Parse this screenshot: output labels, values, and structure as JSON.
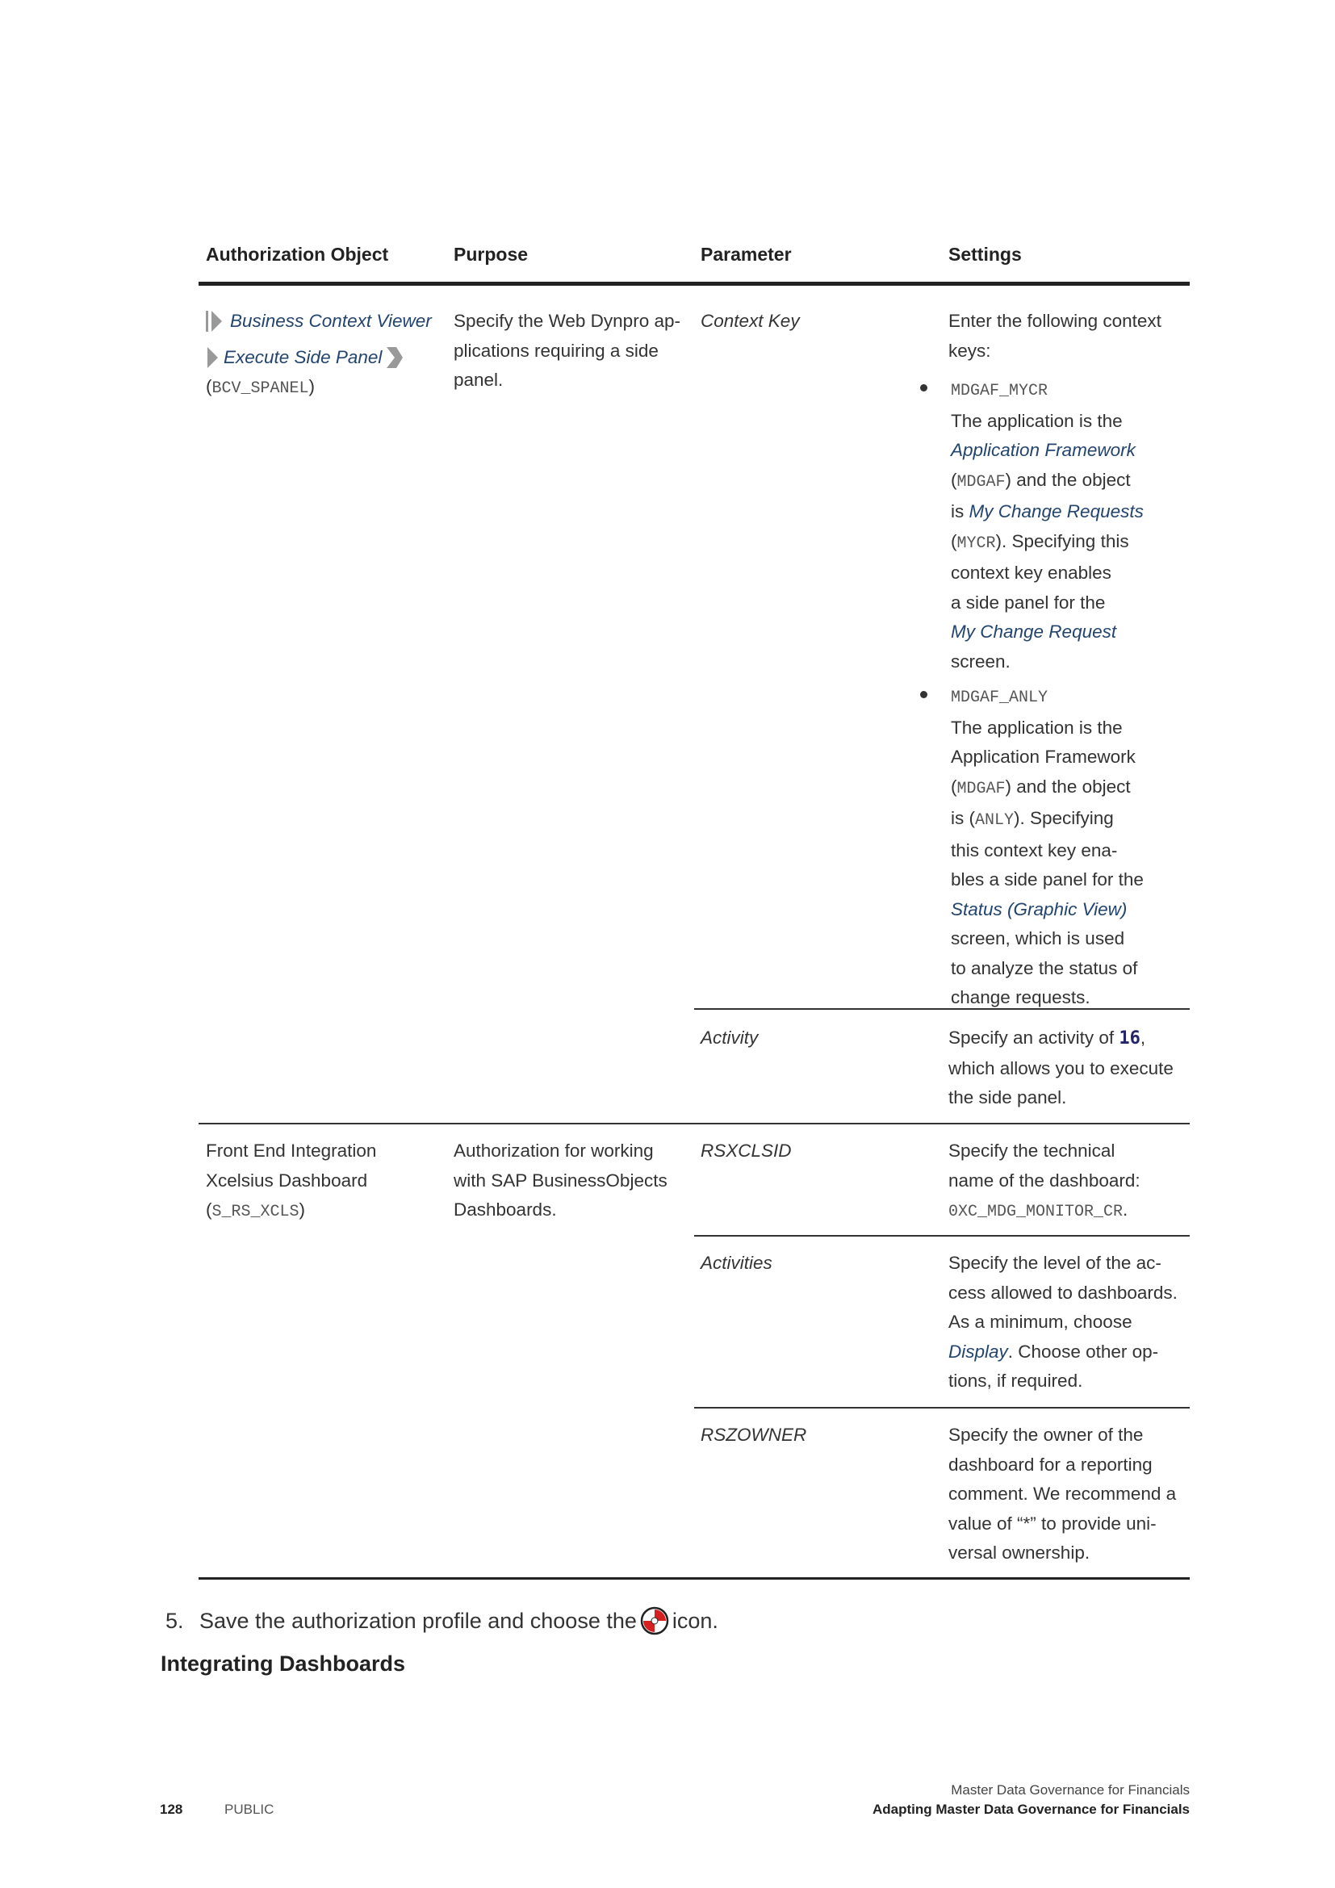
{
  "table": {
    "headers": [
      "Authorization Object",
      "Purpose",
      "Parameter",
      "Settings"
    ],
    "row1": {
      "obj_link1": "Business Context Viewer",
      "obj_link2": "Execute Side Panel",
      "obj_code": "BCV_SPANEL",
      "purpose": "Specify the Web Dynpro ap-plications requiring a side panel.",
      "purpose_lines": [
        "Specify the Web Dynpro ap-",
        "plications requiring a side",
        "panel."
      ],
      "param1": "Context Key",
      "settings1_intro": [
        "Enter the following context",
        "keys:"
      ],
      "bullet1": {
        "code": "MDGAF_MYCR",
        "t1": "The application is the",
        "link1": "Application Framework",
        "code2": "MDGAF",
        "t2": ") and the object",
        "t3": "is ",
        "link2": "My Change Requests",
        "code3": "MYCR",
        "t4": "). Specifying this",
        "t5": "context key enables",
        "t6": "a side panel for the",
        "link3": "My Change Request",
        "t7": "screen."
      },
      "bullet2": {
        "code": "MDGAF_ANLY",
        "t1": "The application is the",
        "t2": "Application Framework",
        "code2": "MDGAF",
        "t3": ") and the object",
        "t4": "is (",
        "code3": "ANLY",
        "t5": "). Specifying",
        "t6": "this context key ena-",
        "t7": "bles a side panel for the",
        "link1": "Status (Graphic View)",
        "t8": "screen, which is used",
        "t9": "to analyze the status of",
        "t10": "change requests."
      },
      "param2": "Activity",
      "settings2_a": "Specify an activity of ",
      "settings2_val": "16",
      "settings2_b": "which allows you to execute",
      "settings2_c": "the side panel."
    },
    "row2": {
      "obj_lines": [
        "Front End Integration",
        "Xcelsius Dashboard"
      ],
      "obj_code": "S_RS_XCLS",
      "purpose_lines": [
        "Authorization for working",
        "with SAP BusinessObjects",
        "Dashboards."
      ],
      "param1": "RSXCLSID",
      "settings1": [
        "Specify the technical",
        "name of the dashboard:"
      ],
      "settings1_code": "0XC_MDG_MONITOR_CR",
      "param2": "Activities",
      "settings2": [
        "Specify the level of the ac-",
        "cess allowed to dashboards.",
        "As a minimum, choose"
      ],
      "settings2_link": "Display",
      "settings2_tail": ". Choose other op-",
      "settings2_last": "tions, if required.",
      "param3": "RSZOWNER",
      "settings3": [
        "Specify the owner of the",
        "dashboard for a reporting",
        "comment. We recommend a",
        "value of “*” to provide uni-",
        "versal ownership."
      ]
    }
  },
  "step": {
    "number": "5.",
    "text_before": "Save the authorization profile and choose the",
    "icon": "save-profile-icon",
    "text_after": "icon."
  },
  "section_heading": "Integrating Dashboards",
  "footer": {
    "page_number": "128",
    "classification": "PUBLIC",
    "doc_title": "Master Data Governance for Financials",
    "chapter_title": "Adapting Master Data Governance for Financials"
  }
}
